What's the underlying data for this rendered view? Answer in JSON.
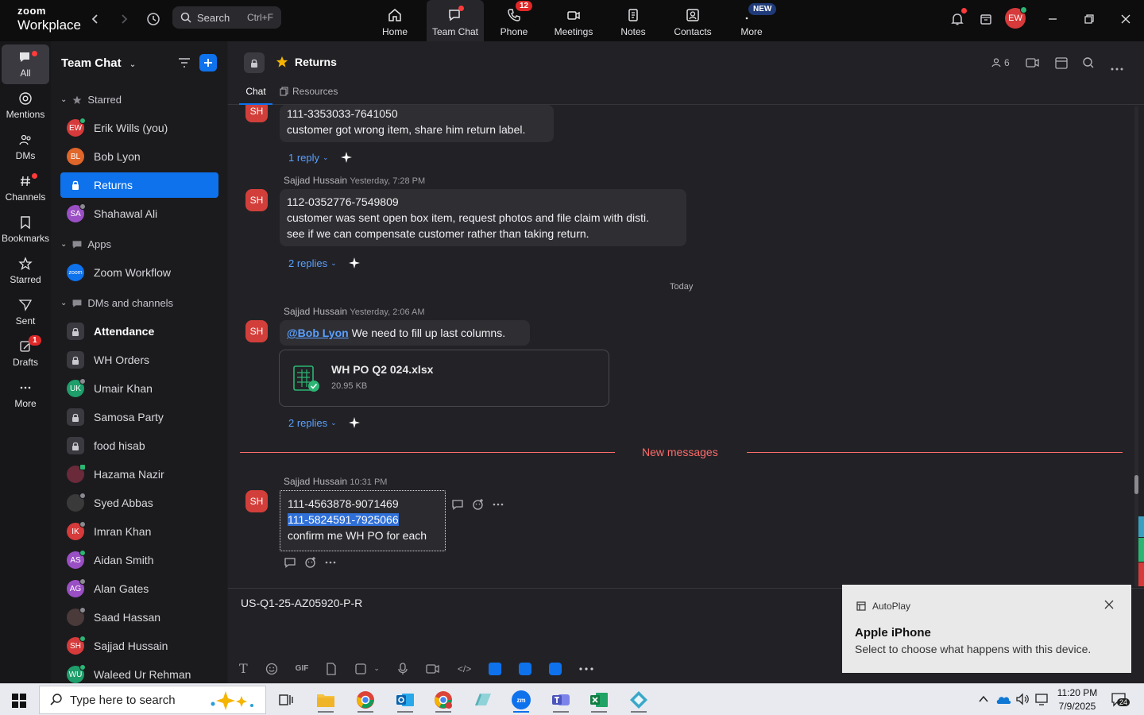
{
  "topbar": {
    "logo_line1": "zoom",
    "logo_line2": "Workplace",
    "search_label": "Search",
    "search_shortcut": "Ctrl+F",
    "tabs": [
      {
        "label": "Home"
      },
      {
        "label": "Team Chat"
      },
      {
        "label": "Phone",
        "badge": "12"
      },
      {
        "label": "Meetings"
      },
      {
        "label": "Notes"
      },
      {
        "label": "Contacts"
      },
      {
        "label": "More",
        "badge": "NEW"
      }
    ],
    "user_initials": "EW"
  },
  "rail": {
    "items": [
      {
        "label": "All"
      },
      {
        "label": "Mentions"
      },
      {
        "label": "DMs"
      },
      {
        "label": "Channels"
      },
      {
        "label": "Bookmarks"
      },
      {
        "label": "Starred"
      },
      {
        "label": "Sent"
      },
      {
        "label": "Drafts",
        "badge": "1"
      },
      {
        "label": "More"
      }
    ]
  },
  "sidebar": {
    "title": "Team Chat",
    "sections": {
      "starred": "Starred",
      "apps": "Apps",
      "dms": "DMs and channels"
    },
    "starred_items": [
      {
        "initials": "EW",
        "label": "Erik Wills (you)",
        "color": "#d63a3a"
      },
      {
        "initials": "BL",
        "label": "Bob Lyon",
        "color": "#e0662a"
      },
      {
        "label": "Returns"
      },
      {
        "initials": "SA",
        "label": "Shahawal Ali",
        "color": "#9a4fc4"
      }
    ],
    "apps_items": [
      {
        "initials": "zoom",
        "label": "Zoom Workflow"
      }
    ],
    "dm_items": [
      {
        "type": "lock",
        "label": "Attendance"
      },
      {
        "type": "lock",
        "label": "WH Orders"
      },
      {
        "initials": "UK",
        "label": "Umair Khan",
        "color": "#1e9e6a"
      },
      {
        "type": "lock",
        "label": "Samosa Party"
      },
      {
        "type": "lock",
        "label": "food hisab"
      },
      {
        "initials": "",
        "label": "Hazama Nazir",
        "color": "#6a2a3a"
      },
      {
        "initials": "",
        "label": "Syed Abbas",
        "color": "#3a3a3a"
      },
      {
        "initials": "IK",
        "label": "Imran Khan",
        "color": "#d63a3a"
      },
      {
        "initials": "AS",
        "label": "Aidan Smith",
        "color": "#9a4fc4"
      },
      {
        "initials": "AG",
        "label": "Alan Gates",
        "color": "#9a4fc4"
      },
      {
        "initials": "",
        "label": "Saad Hassan",
        "color": "#4a3a3a"
      },
      {
        "initials": "SH",
        "label": "Sajjad Hussain",
        "color": "#d63a3a"
      },
      {
        "initials": "WU",
        "label": "Waleed Ur Rehman",
        "color": "#1e9e6a"
      }
    ]
  },
  "channel": {
    "name": "Returns",
    "member_count": "6",
    "tabs": [
      "Chat",
      "Resources"
    ]
  },
  "messages": {
    "m1": {
      "initials": "SH",
      "lines": [
        "111-3353033-7641050",
        "customer got wrong item, share him return label."
      ],
      "replies": "1 reply"
    },
    "m2": {
      "sender": "Sajjad Hussain",
      "time": "Yesterday, 7:28 PM",
      "initials": "SH",
      "lines": [
        "112-0352776-7549809",
        "customer was sent open box item, request photos and file claim with disti.",
        "see if we can compensate customer rather than taking return."
      ],
      "replies": "2 replies"
    },
    "divider_today": "Today",
    "m3": {
      "sender": "Sajjad Hussain",
      "time": "Yesterday, 2:06 AM",
      "initials": "SH",
      "mention": "@Bob Lyon",
      "text": " We need to fill up last columns.",
      "file_name": "WH PO Q2 024.xlsx",
      "file_size": "20.95 KB",
      "replies": "2 replies"
    },
    "new_messages": "New messages",
    "m4": {
      "sender": "Sajjad Hussain",
      "time": "10:31 PM",
      "initials": "SH",
      "line1": "111-4563878-9071469",
      "line2_selected": "111-5824591-7925066",
      "line3": "confirm me WH PO for each"
    }
  },
  "composer": {
    "value": "US-Q1-25-AZ05920-P-R"
  },
  "toast": {
    "app": "AutoPlay",
    "title": "Apple iPhone",
    "body": "Select to choose what happens with this device."
  },
  "taskbar": {
    "search_placeholder": "Type here to search",
    "time": "11:20 PM",
    "date": "7/9/2025",
    "notif_count": "24"
  },
  "colors": {
    "accent": "#0e72ed",
    "danger": "#e02828",
    "new_messages": "#ff6b6b"
  }
}
